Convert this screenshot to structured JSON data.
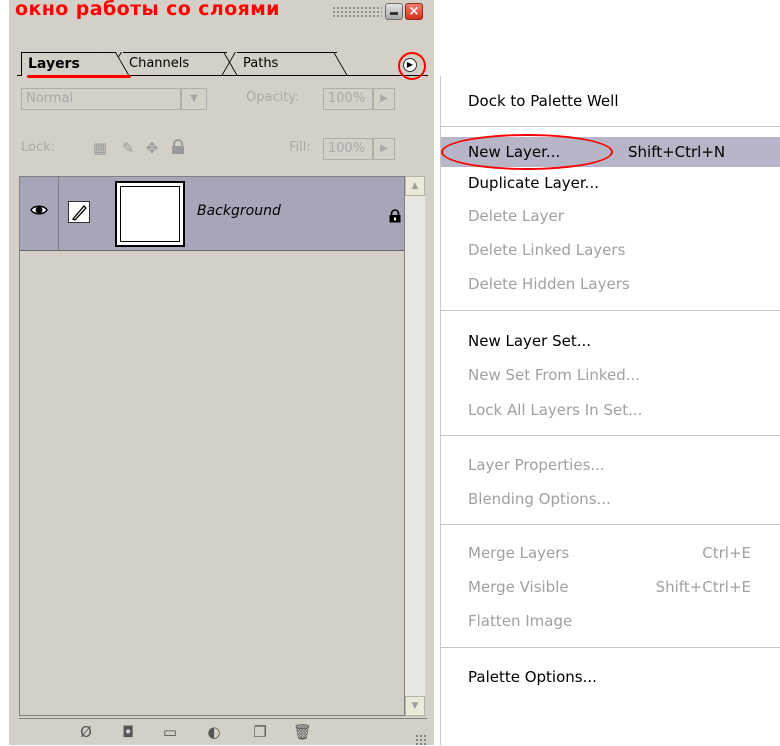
{
  "palette": {
    "title": "окно работы со слоями",
    "close_glyph": "×",
    "tabs": [
      {
        "label": "Layers"
      },
      {
        "label": "Channels"
      },
      {
        "label": "Paths"
      }
    ],
    "blend_mode": "Normal",
    "opacity_label": "Opacity:",
    "opacity_value": "100%",
    "lock_label": "Lock:",
    "fill_label": "Fill:",
    "fill_value": "100%",
    "layers": [
      {
        "name": "Background",
        "visible": true,
        "locked": true
      }
    ],
    "accent": "#ff0000"
  },
  "menu": {
    "items": [
      {
        "label": "Dock to Palette Well",
        "enabled": true
      },
      {
        "label": "New Layer...",
        "shortcut": "Shift+Ctrl+N",
        "enabled": true,
        "highlighted": true
      },
      {
        "label": "Duplicate Layer...",
        "enabled": true
      },
      {
        "label": "Delete Layer",
        "enabled": false
      },
      {
        "label": "Delete Linked Layers",
        "enabled": false
      },
      {
        "label": "Delete Hidden Layers",
        "enabled": false
      },
      {
        "label": "New Layer Set...",
        "enabled": true
      },
      {
        "label": "New Set From Linked...",
        "enabled": false
      },
      {
        "label": "Lock All Layers In Set...",
        "enabled": false
      },
      {
        "label": "Layer Properties...",
        "enabled": false
      },
      {
        "label": "Blending Options...",
        "enabled": false
      },
      {
        "label": "Merge Layers",
        "shortcut": "Ctrl+E",
        "enabled": false
      },
      {
        "label": "Merge Visible",
        "shortcut": "Shift+Ctrl+E",
        "enabled": false
      },
      {
        "label": "Flatten Image",
        "enabled": false
      },
      {
        "label": "Palette Options...",
        "enabled": true
      }
    ],
    "highlight_color": "#b6b6c8"
  }
}
